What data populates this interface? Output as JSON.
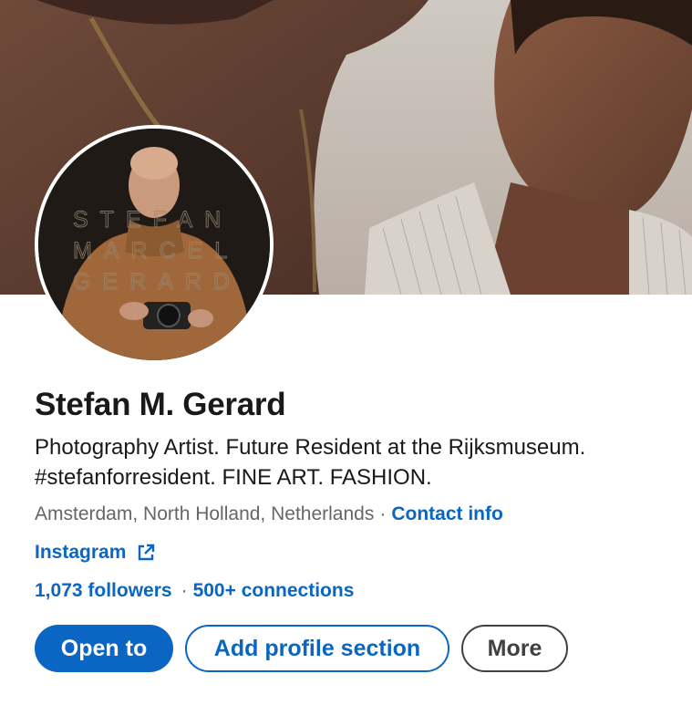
{
  "profile": {
    "cover_image": "cover-photo",
    "avatar_image": "profile-photo",
    "avatar_watermark": [
      "STEFAN",
      "MARCEL",
      "GERARD"
    ],
    "name": "Stefan M. Gerard",
    "headline_line1": "Photography Artist. Future Resident at the Rijksmuseum.",
    "headline_line2": "#stefanforresident. FINE ART. FASHION.",
    "location": "Amsterdam, North Holland, Netherlands",
    "location_separator": "·",
    "contact_info_label": "Contact info",
    "website_label": "Instagram",
    "website_icon": "external-link-icon",
    "followers_label": "1,073 followers",
    "network_separator": "·",
    "connections_label": "500+ connections"
  },
  "actions": {
    "open_to_label": "Open to",
    "add_section_label": "Add profile section",
    "more_label": "More"
  },
  "colors": {
    "brand_blue": "#0a66c2",
    "text_primary": "#191919",
    "text_secondary": "#666666",
    "more_border": "#404040"
  }
}
